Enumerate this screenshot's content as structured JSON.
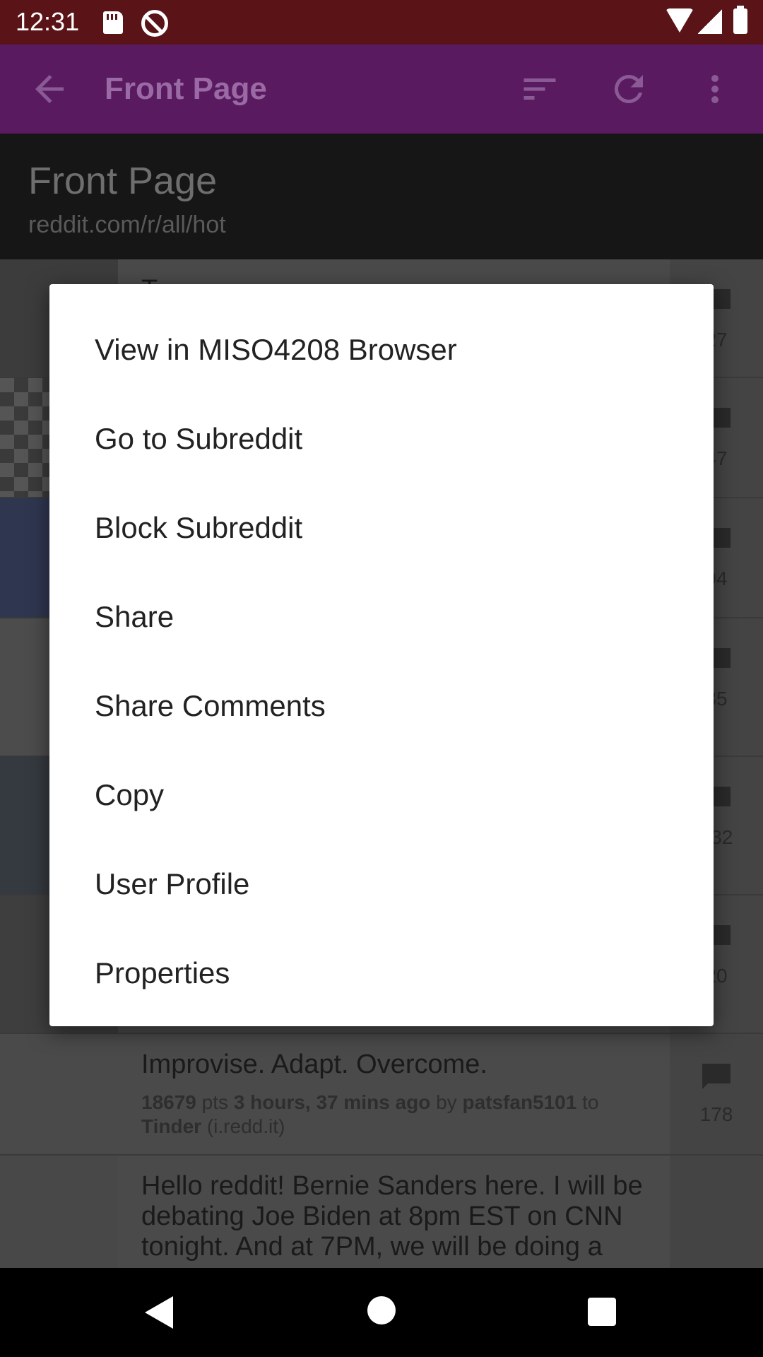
{
  "status_bar": {
    "time": "12:31",
    "icons": [
      "sd-card-icon",
      "notification-icon",
      "wifi-icon",
      "signal-icon",
      "battery-icon"
    ]
  },
  "app_bar": {
    "title": "Front Page",
    "icons": [
      "back-arrow-icon",
      "sort-icon",
      "refresh-icon",
      "more-vert-icon"
    ],
    "color": "#5a1a60"
  },
  "header": {
    "title": "Front Page",
    "url": "reddit.com/r/all/hot"
  },
  "posts": [
    {
      "title": "T",
      "comments": "27"
    },
    {
      "title": "",
      "comments": "47"
    },
    {
      "title": "",
      "comments": "94"
    },
    {
      "title": "",
      "comments": "35"
    },
    {
      "title": "",
      "comments": "932"
    },
    {
      "title": "",
      "comments": "20"
    },
    {
      "title": "Improvise. Adapt. Overcome.",
      "points": "18679",
      "points_suffix": " pts ",
      "time": "3 hours, 37 mins ago",
      "by": " by ",
      "author": "patsfan5101",
      "to": " to",
      "subreddit": "Tinder",
      "domain": " (i.redd.it)",
      "comments": "178"
    },
    {
      "title": "Hello reddit! Bernie Sanders here. I will be debating Joe Biden at 8pm EST on CNN tonight. And at 7PM, we will be doing a"
    }
  ],
  "context_menu": {
    "items": [
      "View in MISO4208 Browser",
      "Go to Subreddit",
      "Block Subreddit",
      "Share",
      "Share Comments",
      "Copy",
      "User Profile",
      "Properties"
    ]
  },
  "nav_bar": {
    "icons": [
      "nav-back-icon",
      "nav-home-icon",
      "nav-recents-icon"
    ]
  }
}
